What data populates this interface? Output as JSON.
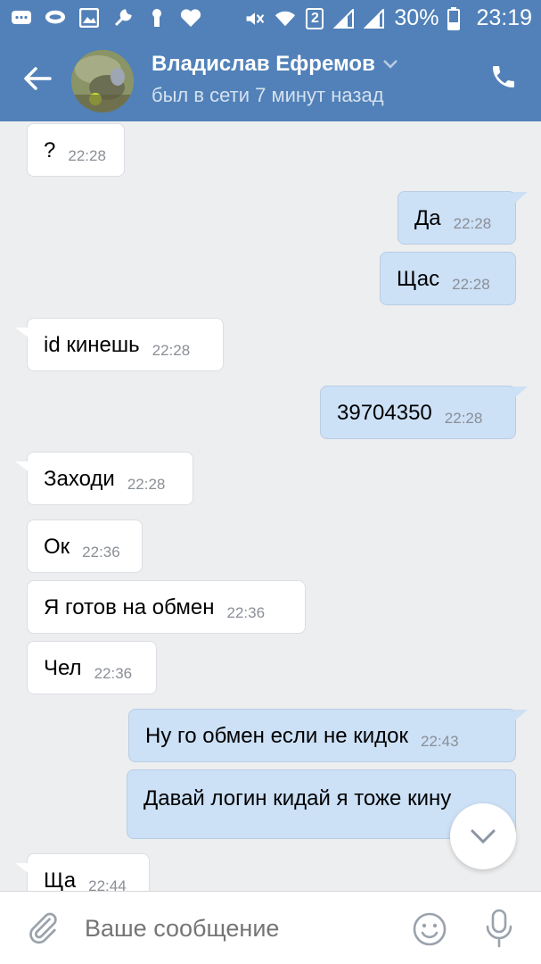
{
  "statusbar": {
    "sim": "2",
    "battery": "30%",
    "time": "23:19",
    "icons": [
      "message-icon",
      "chat-bubble-icon",
      "gallery-icon",
      "wrench-icon",
      "keyhole-icon",
      "heart-icon"
    ]
  },
  "header": {
    "name": "Владислав Ефремов",
    "status": "был в сети 7 минут назад"
  },
  "messages": [
    {
      "text": "?",
      "time": "22:28",
      "dir": "in"
    },
    {
      "text": "Да",
      "time": "22:28",
      "dir": "out"
    },
    {
      "text": "Щас",
      "time": "22:28",
      "dir": "out"
    },
    {
      "text": "id кинешь",
      "time": "22:28",
      "dir": "in"
    },
    {
      "text": "39704350",
      "time": "22:28",
      "dir": "out"
    },
    {
      "text": "Заходи",
      "time": "22:28",
      "dir": "in"
    },
    {
      "text": "Ок",
      "time": "22:36",
      "dir": "in"
    },
    {
      "text": "Я готов на обмен",
      "time": "22:36",
      "dir": "in"
    },
    {
      "text": "Чел",
      "time": "22:36",
      "dir": "in"
    },
    {
      "text": "Ну го обмен если не кидок",
      "time": "22:43",
      "dir": "out"
    },
    {
      "text": "Давай логин кидай я тоже кину",
      "time": "",
      "dir": "out"
    },
    {
      "text": "Ща",
      "time": "22:44",
      "dir": "in"
    }
  ],
  "composer": {
    "placeholder": "Ваше сообщение"
  },
  "colors": {
    "header": "#5181b8",
    "background": "#edeef0",
    "outgoing_bubble": "#cce0f6",
    "incoming_bubble": "#ffffff"
  }
}
